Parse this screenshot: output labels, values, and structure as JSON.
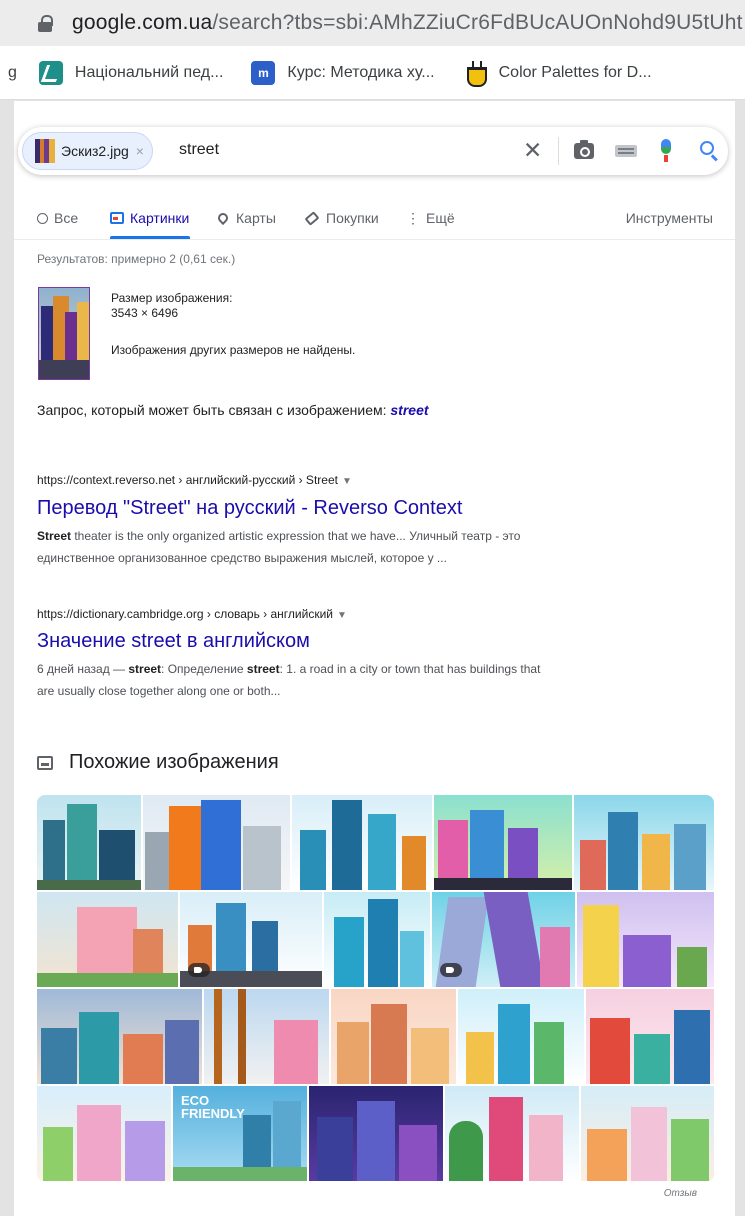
{
  "address_bar": {
    "url_host": "google.com.ua",
    "url_rest": "/search?tbs=sbi:AMhZZiuCr6FdBUcAUOnNohd9U5tUht"
  },
  "bookmarks": {
    "fragment": "g",
    "items": [
      {
        "label": "Національний пед...",
        "icon": "np-logo-icon"
      },
      {
        "label": "Курс: Методика ху...",
        "icon": "moodle-m-icon"
      },
      {
        "label": "Color Palettes for D...",
        "icon": "color-palettes-icon"
      }
    ]
  },
  "search": {
    "chip_label": "Эскиз2.jpg",
    "chip_close": "×",
    "query": "street",
    "clear": "✕"
  },
  "tabs": [
    {
      "label": "Все",
      "icon": "search-icon"
    },
    {
      "label": "Картинки",
      "icon": "image-icon",
      "active": true
    },
    {
      "label": "Карты",
      "icon": "map-pin-icon"
    },
    {
      "label": "Покупки",
      "icon": "tag-icon"
    },
    {
      "label": "Ещё",
      "icon": "more-vert-icon"
    }
  ],
  "tools_label": "Инструменты",
  "stats": "Результатов: примерно 2 (0,61 сек.)",
  "image_info": {
    "size_label": "Размер изображения:",
    "size_value": "3543 × 6496",
    "no_other": "Изображения других размеров не найдены."
  },
  "related": {
    "prefix": "Запрос, который может быть связан с изображением: ",
    "query": "street"
  },
  "results": [
    {
      "cite": "https://context.reverso.net › английский-русский › Street",
      "title": "Перевод \"Street\" на русский - Reverso Context",
      "snippet_bold": "Street",
      "snippet_line1": " theater is the only organized artistic expression that we have... Уличный театр - это",
      "snippet_line2": "единственное организованное средство выражения мыслей, которое у ..."
    },
    {
      "cite": "https://dictionary.cambridge.org › словарь › английский",
      "title": "Значение street в английском",
      "snippet_pre": "6 дней назад — ",
      "snippet_b1": "street",
      "snippet_mid": ": Определение ",
      "snippet_b2": "street",
      "snippet_rest": ": 1. a road in a city or town that has buildings that",
      "snippet_line2": "are usually close together along one or both..."
    }
  ],
  "similar": {
    "heading": "Похожие изображения",
    "badge_text": "ECO FRIENDLY"
  },
  "feedback": "Отзыв",
  "colors": {
    "link": "#1a0dab",
    "accent": "#1a73e8",
    "text_secondary": "#70757a"
  }
}
